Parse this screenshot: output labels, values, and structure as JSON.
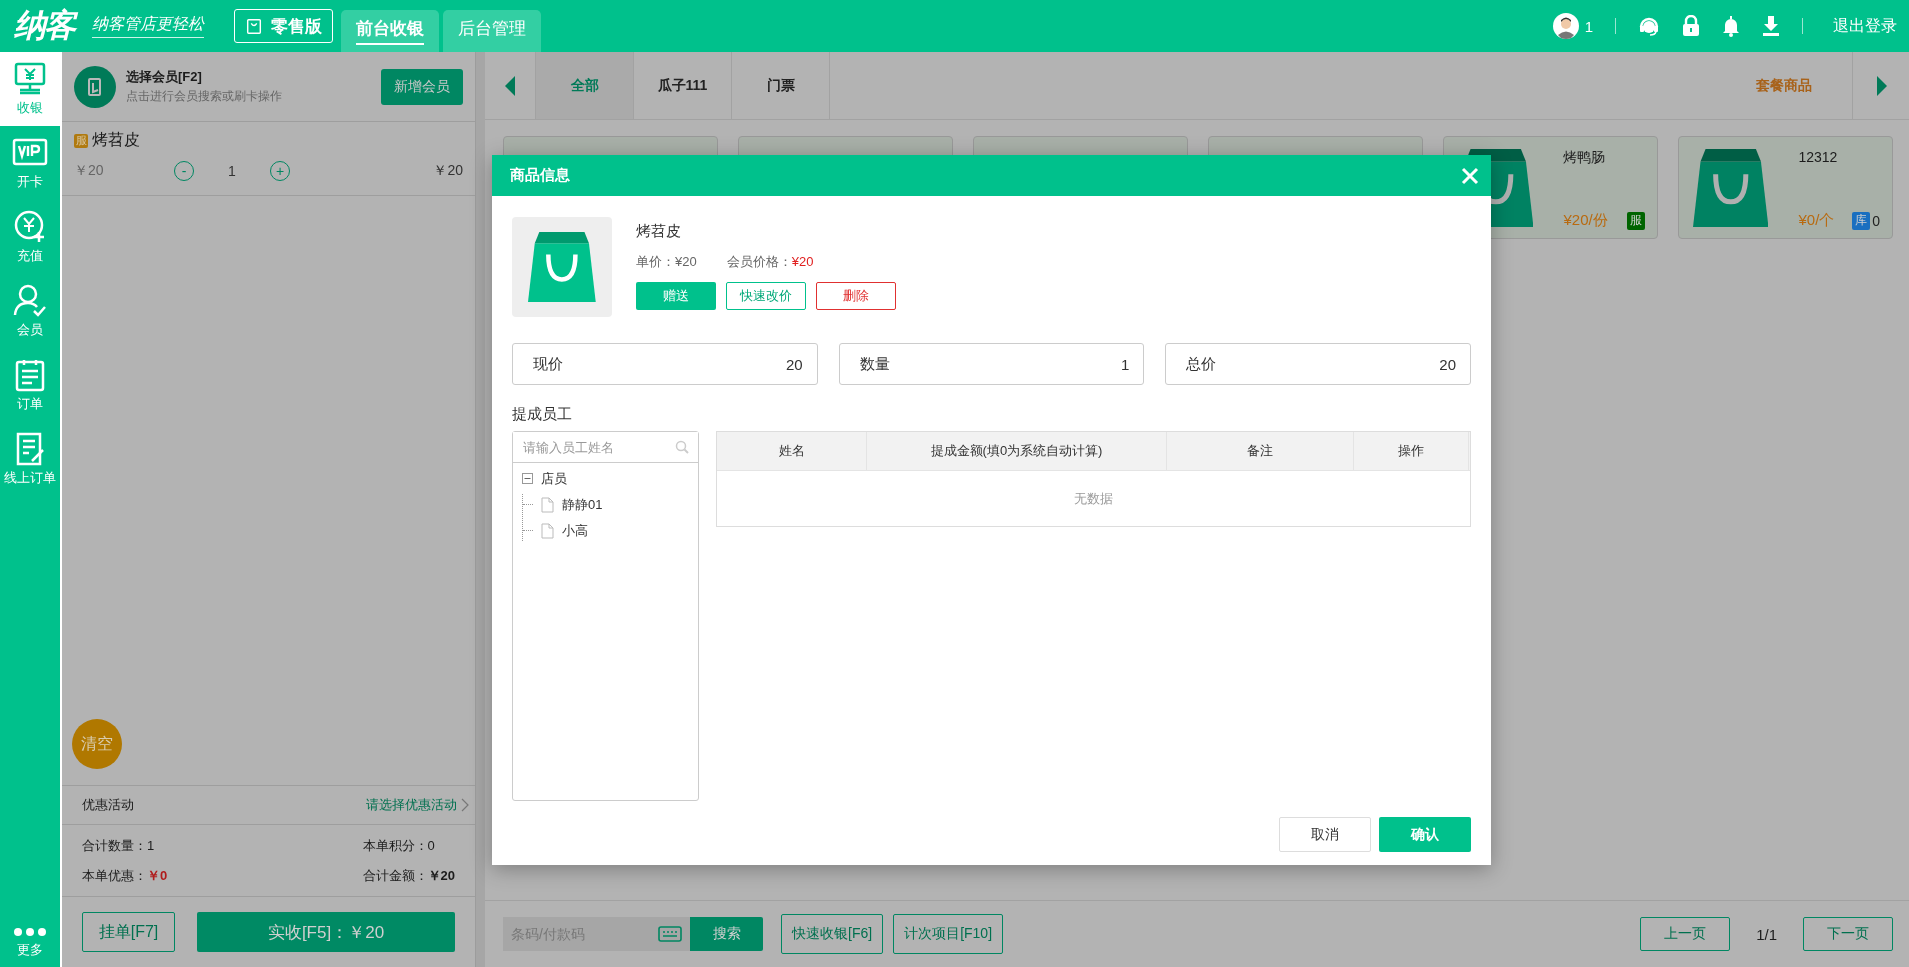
{
  "header": {
    "logo": "纳客",
    "slogan": "纳客管店更轻松",
    "edition": "零售版",
    "tabs": [
      {
        "label": "前台收银",
        "selected": true
      },
      {
        "label": "后台管理",
        "selected": false
      }
    ],
    "user_count": "1",
    "logout": "退出登录"
  },
  "nav": [
    {
      "kind": "cashier",
      "label": "收银",
      "selected": true
    },
    {
      "kind": "vip",
      "label": "开卡",
      "selected": false
    },
    {
      "kind": "recharge",
      "label": "充值",
      "selected": false
    },
    {
      "kind": "member",
      "label": "会员",
      "selected": false
    },
    {
      "kind": "order",
      "label": "订单",
      "selected": false
    },
    {
      "kind": "online",
      "label": "线上订单",
      "selected": false
    },
    {
      "kind": "more",
      "label": "更多",
      "selected": false
    }
  ],
  "cart": {
    "member": {
      "title": "选择会员[F2]",
      "hint": "点击进行会员搜索或刷卡操作",
      "add_button": "新增会员"
    },
    "items": [
      {
        "tag": "服",
        "name": "烤苕皮",
        "price": "￥20",
        "minus": "-",
        "qty": "1",
        "plus": "+",
        "subtotal": "￥20"
      }
    ],
    "clear": "清空",
    "promo": {
      "label": "优惠活动",
      "value": "请选择优惠活动"
    },
    "totals": {
      "qty": "合计数量：1",
      "points": "本单积分：0",
      "discount_label": "本单优惠：",
      "discount": "￥0",
      "amount_label": "合计金额：",
      "amount": "￥20"
    },
    "hold_button": "挂单[F7]",
    "pay_button": "实收[F5]：￥20"
  },
  "goods": {
    "categories": [
      {
        "label": "全部",
        "selected": true
      },
      {
        "label": "瓜子111",
        "selected": false
      },
      {
        "label": "门票",
        "selected": false
      }
    ],
    "package": "套餐商品",
    "products": [
      {
        "kind": "covered"
      },
      {
        "kind": "covered"
      },
      {
        "kind": "covered"
      },
      {
        "kind": "covered"
      },
      {
        "kind": "item",
        "name": "烤鸭肠",
        "price": "¥20/份",
        "badge": "服",
        "color": "#006400"
      },
      {
        "kind": "item",
        "name": "12312",
        "price": "¥0/个",
        "badge": "库",
        "color": "#1a6fc0",
        "stock": "0"
      }
    ],
    "search": {
      "placeholder": "条码/付款码",
      "button": "搜索"
    },
    "quick_buttons": [
      "快速收银[F6]",
      "计次项目[F10]"
    ],
    "pager": {
      "prev": "上一页",
      "page": "1/1",
      "next": "下一页"
    }
  },
  "modal": {
    "title": "商品信息",
    "product": "烤苕皮",
    "unit_price": "单价：¥20",
    "member_price_label": "会员价格：",
    "member_price": "¥20",
    "actions": [
      {
        "kind": "primary",
        "label": "赠送"
      },
      {
        "kind": "outline",
        "label": "快速改价"
      },
      {
        "kind": "danger",
        "label": "删除"
      }
    ],
    "fields": [
      {
        "label": "现价",
        "value": "20"
      },
      {
        "label": "数量",
        "value": "1"
      },
      {
        "label": "总价",
        "value": "20"
      }
    ],
    "staff_label": "提成员工",
    "staff_search": {
      "placeholder": "请输入员工姓名"
    },
    "tree": [
      {
        "label": "店员",
        "expanded": true,
        "children": [
          {
            "label": "静静01"
          },
          {
            "label": "小高"
          }
        ]
      }
    ],
    "table": {
      "columns": [
        "姓名",
        "提成金额(填0为系统自动计算)",
        "备注",
        "操作"
      ],
      "empty": "无数据"
    },
    "buttons": {
      "cancel": "取消",
      "confirm": "确认"
    }
  }
}
